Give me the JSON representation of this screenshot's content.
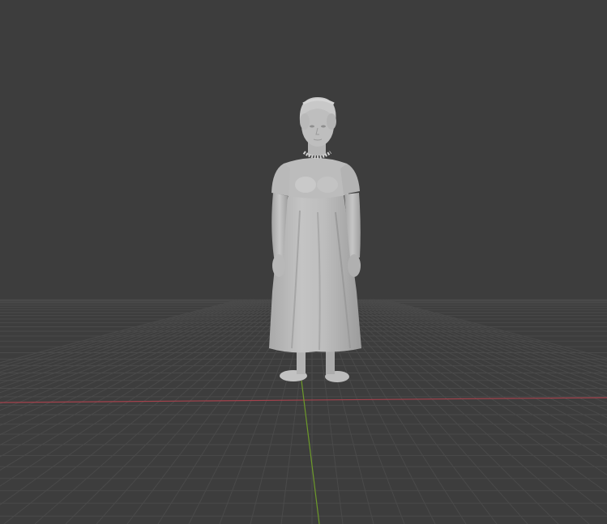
{
  "viewport": {
    "background_color": "#3d3d3d",
    "grid_color": "#4a4a4a",
    "x_axis_color": "#b2444f",
    "y_axis_color": "#6d9a2a",
    "model_color": "#b9b9b9",
    "model_shadow_color": "#8f8f8f",
    "model_highlight_color": "#d2d2d2",
    "model": "statue-of-woman-in-regency-dress",
    "shading_mode": "solid"
  }
}
